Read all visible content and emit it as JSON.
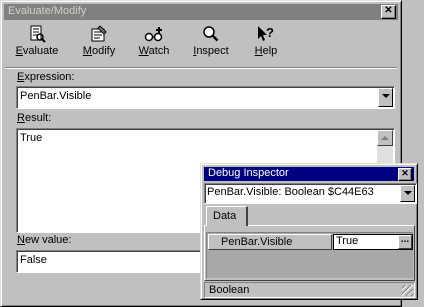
{
  "main_window": {
    "title": "Evaluate/Modify",
    "toolbar": [
      {
        "label": "Evaluate",
        "icon": "evaluate-icon"
      },
      {
        "label": "Modify",
        "icon": "modify-icon"
      },
      {
        "label": "Watch",
        "icon": "watch-icon"
      },
      {
        "label": "Inspect",
        "icon": "inspect-icon"
      },
      {
        "label": "Help",
        "icon": "help-icon"
      }
    ],
    "expression_label": "Expression:",
    "expression_value": "PenBar.Visible",
    "result_label": "Result:",
    "result_value": "True",
    "new_value_label": "New value:",
    "new_value": "False"
  },
  "inspector": {
    "title": "Debug Inspector",
    "object_value": "PenBar.Visible: Boolean $C44E63",
    "tab_label": "Data",
    "row_name": "PenBar.Visible",
    "row_value": "True",
    "ellipsis_label": "...",
    "status_text": "Boolean"
  },
  "colors": {
    "active_title": "#000080",
    "inactive_title": "#808080",
    "face": "#c0c0c0"
  }
}
